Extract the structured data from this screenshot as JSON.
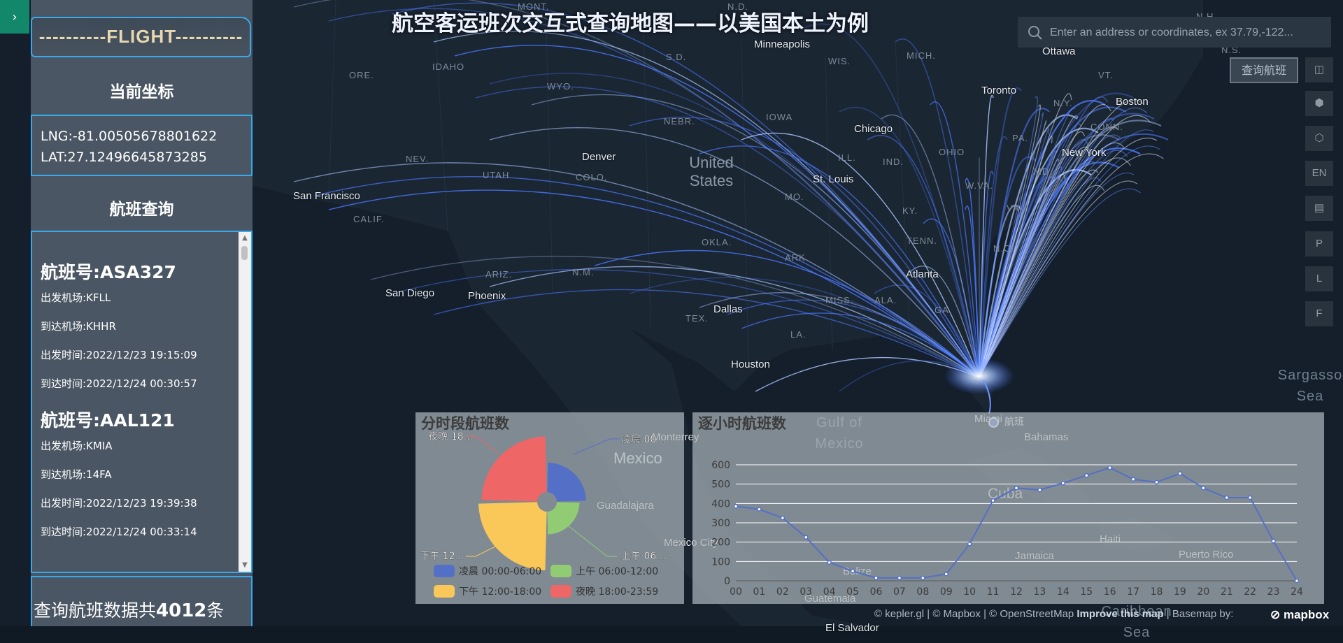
{
  "title": "航空客运班次交互式查询地图——以美国本土为例",
  "sidebar_toggle": "›",
  "panel": {
    "logo": "----------FLIGHT----------",
    "coord_title": "当前坐标",
    "lng": "LNG:-81.00505678801622",
    "lat": "LAT:27.12496645873285",
    "query_title": "航班查询",
    "flights": [
      {
        "no": "航班号:ASA327",
        "dep_airport": "出发机场:KFLL",
        "arr_airport": "到达机场:KHHR",
        "dep_time": "出发时间:2022/12/23 19:15:09",
        "arr_time": "到达时间:2022/12/24 00:30:57"
      },
      {
        "no": "航班号:AAL121",
        "dep_airport": "出发机场:KMIA",
        "arr_airport": "到达机场:14FA",
        "dep_time": "出发时间:2022/12/23 19:39:38",
        "arr_time": "到达时间:2022/12/24 00:33:14"
      }
    ],
    "total_prefix": "查询航班数据共",
    "total_count": "4012",
    "total_suffix": "条"
  },
  "search": {
    "placeholder": "Enter an address or coordinates, ex 37.79,-122..."
  },
  "query_button": "查询航班",
  "toolbar": [
    "◫",
    "⬢",
    "⬡",
    "EN",
    "▤",
    "P",
    "L",
    "F"
  ],
  "map": {
    "layer_legend": "航班",
    "cities": [
      "Minneapolis",
      "Ottawa",
      "Toronto",
      "Boston",
      "Chicago",
      "New York",
      "Denver",
      "St. Louis",
      "San Francisco",
      "San Diego",
      "Phoenix",
      "Dallas",
      "Atlanta",
      "Houston",
      "Monterrey",
      "Guadalajara",
      "Mexico City",
      "Miami",
      "Bahamas",
      "Cuba",
      "Haiti",
      "Jamaica",
      "Puerto Rico",
      "Belize",
      "Guatemala",
      "El Salvador"
    ],
    "states": [
      "MONT.",
      "N.D.",
      "IDAHO",
      "ORE.",
      "WYO.",
      "S.D.",
      "WIS.",
      "MICH.",
      "VT.",
      "N.H.",
      "N.Y.",
      "NEBR.",
      "IOWA",
      "NEV.",
      "UTAH",
      "COLO.",
      "ILL.",
      "IND.",
      "OHIO",
      "PA.",
      "CONN.",
      "MD.",
      "W.VA.",
      "VA.",
      "CALIF.",
      "MO.",
      "KY.",
      "OKLA.",
      "ARK.",
      "TENN.",
      "N.C.",
      "ARIZ.",
      "N.M.",
      "MISS.",
      "ALA.",
      "GA.",
      "TEX.",
      "LA.",
      "N.S."
    ],
    "countries": [
      "United States",
      "Mexico"
    ],
    "seas": [
      "Gulf of Mexico",
      "Sargasso Sea",
      "Caribbean Sea"
    ]
  },
  "attribution": {
    "text": "© kepler.gl | © Mapbox | © OpenStreetMap ",
    "improve": "Improve this map",
    "basemap": " | Basemap by: ",
    "logo": "⊘ mapbox"
  },
  "colors": {
    "winter": "#5470c6",
    "morning": "#91cc75",
    "afternoon": "#fac858",
    "evening": "#ee6666",
    "arc": "#4a78ff",
    "panel_border": "#39a9ee"
  },
  "chart_data": [
    {
      "type": "pie",
      "title": "分时段航班数",
      "categories": [
        "凌晨 00:00-06:00",
        "上午 06:00-12:00",
        "下午 12:00-18:00",
        "夜晚 18:00-23:59"
      ],
      "labels": [
        "凌晨 00...",
        "上午 06...",
        "下午 12...",
        "夜晚 18..."
      ],
      "values": [
        500,
        300,
        2000,
        1800
      ],
      "rose": true,
      "legend_position": "bottom"
    },
    {
      "type": "line",
      "title": "逐小时航班数",
      "categories": [
        "00",
        "01",
        "02",
        "03",
        "04",
        "05",
        "06",
        "07",
        "08",
        "09",
        "10",
        "11",
        "12",
        "13",
        "14",
        "15",
        "16",
        "17",
        "18",
        "19",
        "20",
        "21",
        "22",
        "23",
        "24"
      ],
      "values": [
        385,
        370,
        325,
        225,
        95,
        50,
        15,
        15,
        15,
        35,
        190,
        415,
        480,
        470,
        505,
        545,
        585,
        525,
        510,
        555,
        480,
        430,
        430,
        205,
        0
      ],
      "ylim": [
        0,
        600
      ],
      "yticks": [
        0,
        100,
        200,
        300,
        400,
        500,
        600
      ],
      "grid": true
    }
  ]
}
